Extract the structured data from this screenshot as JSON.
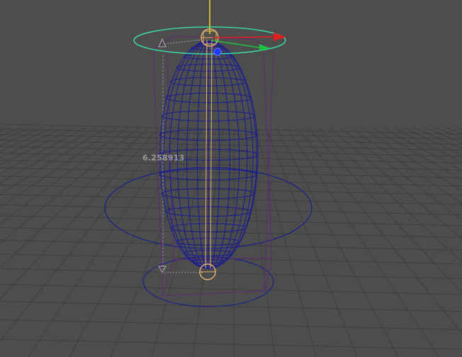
{
  "viewport": {
    "name": "3d-viewport",
    "measurement_label": "6.258913"
  },
  "colors": {
    "background": "#4d4d4d",
    "grid": "#3f3f3f",
    "wireframe": "#1b1f8c",
    "bounding_box": "#5a3070",
    "manipulator_ring": "#39e6b0",
    "joint": "#e6b36b",
    "axis_x": "#e02020",
    "axis_y": "#e8e020",
    "axis_z": "#1e3cff",
    "axis_green": "#20c040"
  },
  "icons": {
    "top_handle": "cone-handle-icon",
    "bottom_handle": "cone-handle-icon",
    "x_arrow": "arrow-right-icon",
    "y_arrow": "arrow-up-icon",
    "z_handle": "sphere-handle-icon"
  }
}
